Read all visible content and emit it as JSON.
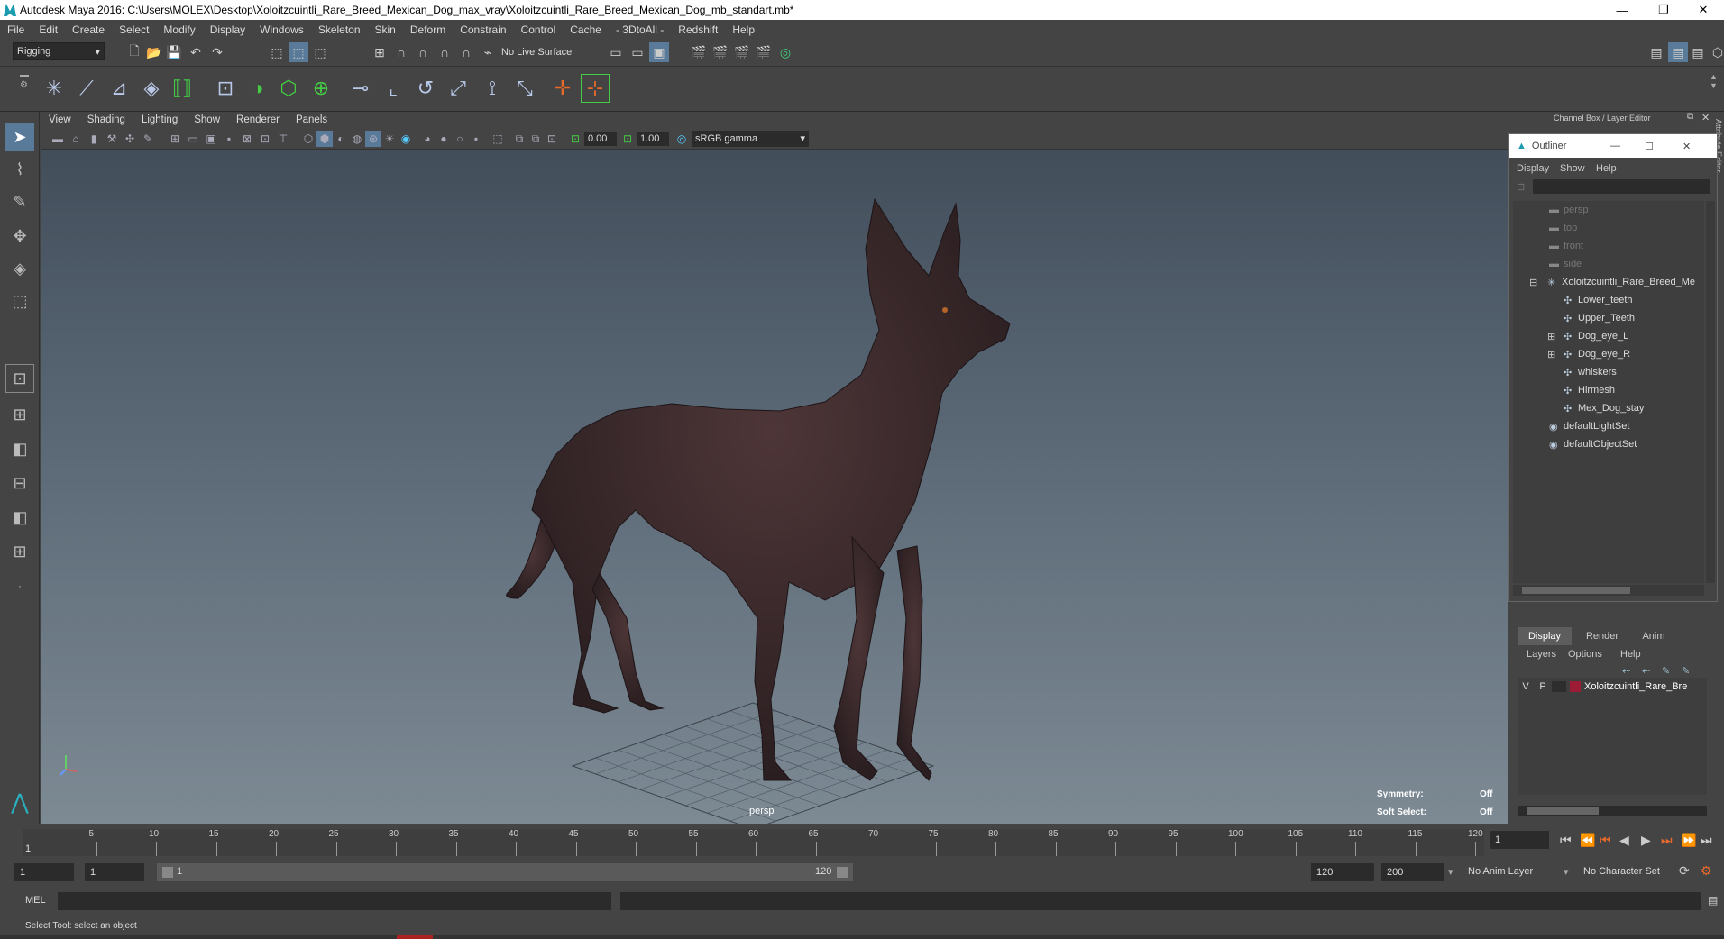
{
  "window": {
    "title": "Autodesk Maya 2016: C:\\Users\\MOLEX\\Desktop\\Xoloitzcuintli_Rare_Breed_Mexican_Dog_max_vray\\Xoloitzcuintli_Rare_Breed_Mexican_Dog_mb_standart.mb*",
    "minimize": "—",
    "restore": "❐",
    "close": "✕"
  },
  "menubar": [
    "File",
    "Edit",
    "Create",
    "Select",
    "Modify",
    "Display",
    "Windows",
    "Skeleton",
    "Skin",
    "Deform",
    "Constrain",
    "Control",
    "Cache",
    "- 3DtoAll -",
    "Redshift",
    "Help"
  ],
  "status": {
    "mode": "Rigging",
    "live_surface": "No Live Surface"
  },
  "viewport": {
    "menu": [
      "View",
      "Shading",
      "Lighting",
      "Show",
      "Renderer",
      "Panels"
    ],
    "exposure": "0.00",
    "gamma": "1.00",
    "color_space": "sRGB gamma",
    "camera_label": "persp",
    "hud": {
      "symmetry_label": "Symmetry:",
      "symmetry_value": "Off",
      "soft_select_label": "Soft Select:",
      "soft_select_value": "Off"
    }
  },
  "channelbox": {
    "title": "Channel Box / Layer Editor"
  },
  "side_tabs": {
    "attribute_editor": "Attribute Editor",
    "channel_box": "Channel Box / Layer Editor"
  },
  "outliner": {
    "title": "Outliner",
    "menu": [
      "Display",
      "Show",
      "Help"
    ],
    "items": [
      {
        "label": "persp",
        "dim": true,
        "indent": 0
      },
      {
        "label": "top",
        "dim": true,
        "indent": 0
      },
      {
        "label": "front",
        "dim": true,
        "indent": 0
      },
      {
        "label": "side",
        "dim": true,
        "indent": 0
      },
      {
        "label": "Xoloitzcuintli_Rare_Breed_Me",
        "dim": false,
        "indent": 0
      },
      {
        "label": "Lower_teeth",
        "dim": false,
        "indent": 1
      },
      {
        "label": "Upper_Teeth",
        "dim": false,
        "indent": 1
      },
      {
        "label": "Dog_eye_L",
        "dim": false,
        "indent": 1
      },
      {
        "label": "Dog_eye_R",
        "dim": false,
        "indent": 1
      },
      {
        "label": "whiskers",
        "dim": false,
        "indent": 1
      },
      {
        "label": "Hirmesh",
        "dim": false,
        "indent": 1
      },
      {
        "label": "Mex_Dog_stay",
        "dim": false,
        "indent": 1
      },
      {
        "label": "defaultLightSet",
        "dim": false,
        "indent": 0
      },
      {
        "label": "defaultObjectSet",
        "dim": false,
        "indent": 0
      }
    ]
  },
  "layer_editor": {
    "tabs": [
      "Display",
      "Render",
      "Anim"
    ],
    "menu": [
      "Layers",
      "Options",
      "Help"
    ],
    "layer": {
      "v": "V",
      "p": "P",
      "name": "Xoloitzcuintli_Rare_Bre",
      "color": "#9b1c34"
    }
  },
  "timeline": {
    "ticks": [
      "5",
      "10",
      "15",
      "20",
      "25",
      "30",
      "35",
      "40",
      "45",
      "50",
      "55",
      "60",
      "65",
      "70",
      "75",
      "80",
      "85",
      "90",
      "95",
      "100",
      "105",
      "110",
      "115",
      "120"
    ],
    "start_label": "1",
    "current_frame": "1"
  },
  "range": {
    "start": "1",
    "playback_start": "1",
    "slider_start": "1",
    "slider_end": "120",
    "playback_end": "120",
    "end": "200",
    "anim_layer": "No Anim Layer",
    "char_set": "No Character Set"
  },
  "cmdline": {
    "label": "MEL"
  },
  "helpline": {
    "text": "Select Tool: select an object"
  }
}
